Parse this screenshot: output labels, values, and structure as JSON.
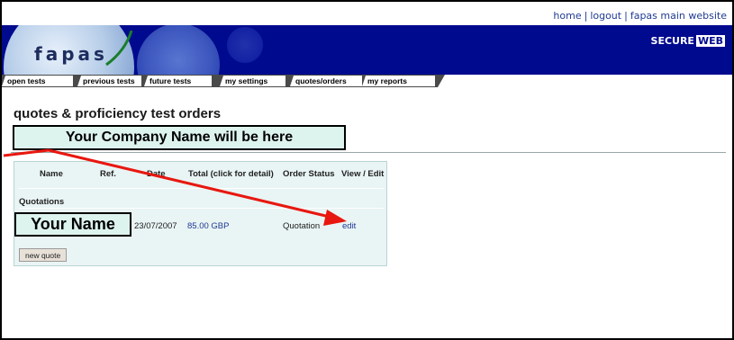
{
  "header": {
    "links": [
      "home",
      "logout",
      "fapas main website"
    ],
    "separator": "|",
    "logo_text": "fapas",
    "secure_label": "SECURE",
    "secure_web": "WEB"
  },
  "tabs": [
    {
      "label": "open tests"
    },
    {
      "label": "previous tests"
    },
    {
      "label": "future tests"
    },
    {
      "label": "my settings"
    },
    {
      "label": "quotes/orders"
    },
    {
      "label": "my reports"
    }
  ],
  "page": {
    "subtitle": "quotes & proficiency test orders",
    "company_placeholder": "Your Company Name will be here"
  },
  "table": {
    "headers": [
      "Name",
      "Ref.",
      "Date",
      "Total (click for detail)",
      "Order Status",
      "View / Edit"
    ],
    "section_label": "Quotations",
    "row": {
      "name": "Your Name",
      "date": "23/07/2007",
      "total": "85.00 GBP",
      "status": "Quotation",
      "action": "edit"
    }
  },
  "buttons": {
    "new_quote": "new quote"
  },
  "annotation": {
    "color": "#e8170f"
  }
}
